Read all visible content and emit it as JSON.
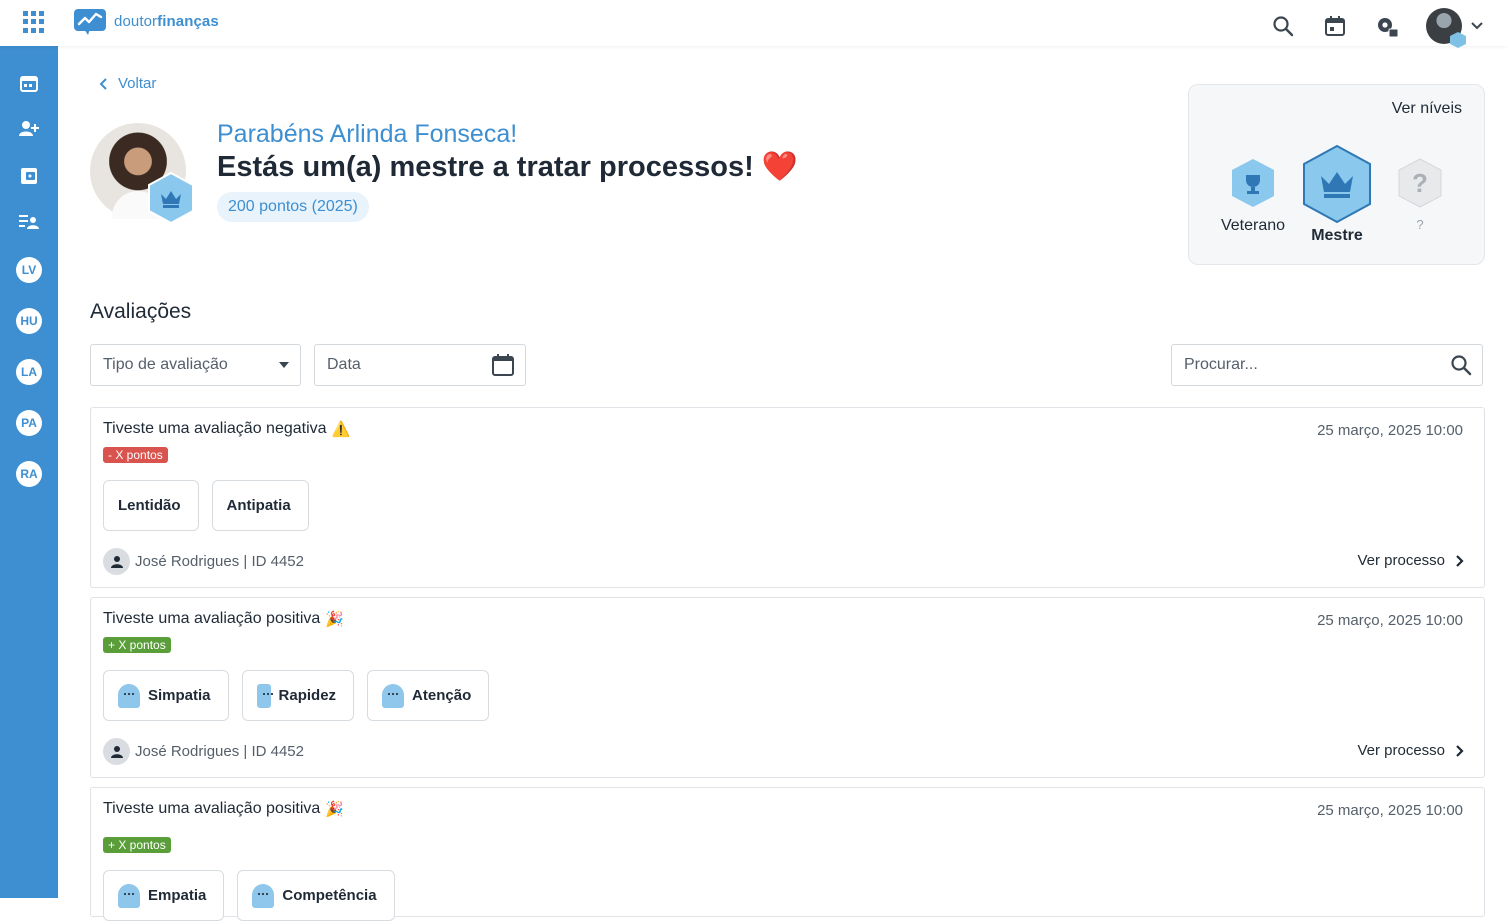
{
  "topbar": {
    "brand_plain": "doutor",
    "brand_bold": "finanças",
    "icons": [
      "apps-grid-icon",
      "search-icon",
      "calendar-icon",
      "settings-lock-icon",
      "avatar",
      "chevron-down-icon"
    ]
  },
  "sidebar": {
    "icons": [
      "calendar-icon",
      "add-user-icon",
      "wallet-icon",
      "user-list-icon"
    ],
    "users": [
      "LV",
      "HU",
      "LA",
      "PA",
      "RA"
    ]
  },
  "back_label": "Voltar",
  "profile": {
    "congrats": "Parabéns Arlinda Fonseca!",
    "headline": "Estás um(a) mestre a tratar processos!",
    "headline_emoji": "❤️",
    "points": "200 pontos (2025)"
  },
  "levels": {
    "link": "Ver níveis",
    "items": [
      {
        "label": "Veterano",
        "icon": "trophy-icon"
      },
      {
        "label": "Mestre",
        "icon": "crown-icon",
        "current": true
      },
      {
        "label": "?",
        "icon": "question-icon"
      }
    ]
  },
  "section_title": "Avaliações",
  "filters": {
    "type_placeholder": "Tipo de avaliação",
    "date_placeholder": "Data",
    "search_placeholder": "Procurar..."
  },
  "reviews": [
    {
      "title": "Tiveste uma avaliação negativa",
      "emoji": "⚠️",
      "date": "25 março, 2025 10:00",
      "tag": "- X pontos",
      "chips": [
        "Lentidão",
        "Antipatia"
      ],
      "reviewer": "José Rodrigues | ID 4452",
      "link": "Ver processo"
    },
    {
      "title": "Tiveste uma avaliação positiva",
      "emoji": "🎉",
      "date": "25 março, 2025 10:00",
      "tag": "+ X pontos",
      "chips": [
        "Simpatia",
        "Rapidez",
        "Atenção"
      ],
      "reviewer": "José Rodrigues | ID 4452",
      "link": "Ver processo"
    },
    {
      "title": "Tiveste uma avaliação positiva",
      "emoji": "🎉",
      "date": "25 março, 2025 10:00",
      "tag": "+ X pontos",
      "chips": [
        "Empatia",
        "Competência"
      ]
    }
  ],
  "colors": {
    "accent": "#3d8fd1",
    "negative": "#d9534f",
    "positive": "#5a9e3a"
  }
}
